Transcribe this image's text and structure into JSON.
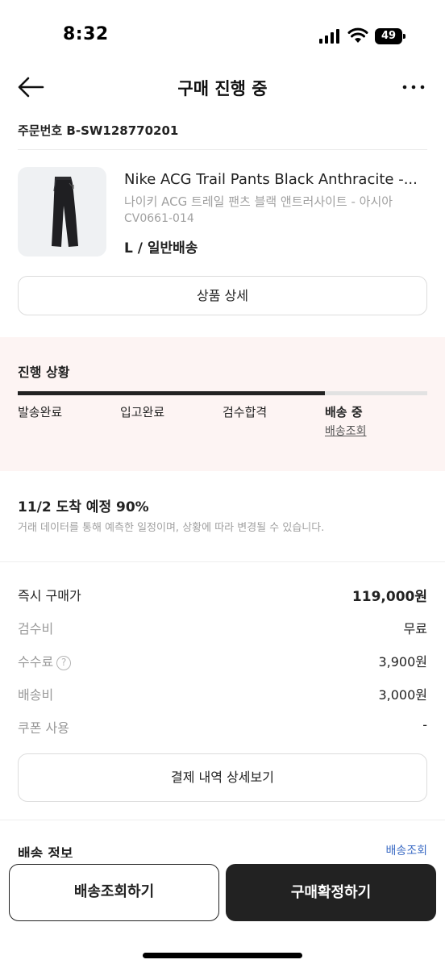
{
  "status_bar": {
    "time": "8:32",
    "battery": "49"
  },
  "header": {
    "title": "구매 진행 중"
  },
  "order": {
    "number": "주문번호 B-SW128770201"
  },
  "product": {
    "name": "Nike ACG Trail Pants Black Anthracite -...",
    "name_kr": "나이키 ACG 트레일 팬츠 블랙 앤트러사이트 - 아시아",
    "code": "CV0661-014",
    "option": "L / 일반배송",
    "detail_button": "상품 상세"
  },
  "progress": {
    "title": "진행 상황",
    "completed_fraction": 0.75,
    "steps": [
      {
        "label": "발송완료"
      },
      {
        "label": "입고완료"
      },
      {
        "label": "검수합격"
      },
      {
        "label": "배송 중",
        "link": "배송조회"
      }
    ]
  },
  "arrival": {
    "title": "11/2 도착 예정 90%",
    "description": "거래 데이터를 통해 예측한 일정이며, 상황에 따라 변경될 수 있습니다."
  },
  "payment": {
    "rows": [
      {
        "label": "즉시 구매가",
        "value": "119,000원"
      },
      {
        "label": "검수비",
        "value": "무료"
      },
      {
        "label": "수수료",
        "value": "3,900원"
      },
      {
        "label": "배송비",
        "value": "3,000원"
      },
      {
        "label": "쿠폰 사용",
        "value": "-"
      }
    ],
    "help_icon_glyph": "?",
    "detail_button": "결제 내역 상세보기"
  },
  "delivery": {
    "title": "배송 정보",
    "link": "배송조회"
  },
  "actions": {
    "track_button": "배송조회하기",
    "confirm_button": "구매확정하기"
  },
  "icons": {
    "back": "arrow-left-icon",
    "more": "more-horizontal-icon",
    "help": "question-circle-icon"
  }
}
